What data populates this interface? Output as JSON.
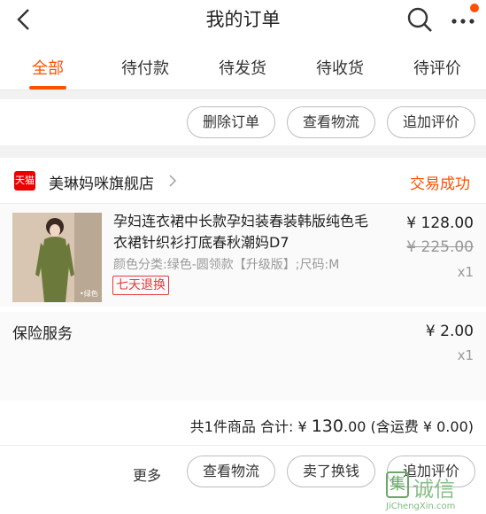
{
  "header": {
    "title": "我的订单"
  },
  "tabs": [
    {
      "label": "全部",
      "active": true
    },
    {
      "label": "待付款",
      "active": false
    },
    {
      "label": "待发货",
      "active": false
    },
    {
      "label": "待收货",
      "active": false
    },
    {
      "label": "待评价",
      "active": false
    }
  ],
  "previous_order": {
    "actions": [
      "删除订单",
      "查看物流",
      "追加评价"
    ]
  },
  "order": {
    "shop_logo_text": "天猫",
    "shop_name": "美琳妈咪旗舰店",
    "status": "交易成功",
    "item": {
      "title": "孕妇连衣裙中长款孕妇装春装韩版纯色毛衣裙针织衫打底春秋潮妈D7",
      "sku": "颜色分类:绿色-圆领款【升级版】;尺码:M",
      "tag": "七天退换",
      "price": "¥ 128.00",
      "original_price": "¥ 225.00",
      "quantity": "x1",
      "thumb_caption": "•绿色"
    },
    "insurance": {
      "label": "保险服务",
      "price": "¥ 2.00",
      "quantity": "x1"
    },
    "summary": {
      "count_text": "共1件商品",
      "total_label": "合计:",
      "currency": "¥",
      "total": "130",
      "total_decimals": ".00",
      "shipping_text": "(含运费 ¥ 0.00)"
    },
    "more_label": "更多",
    "actions": [
      "查看物流",
      "卖了换钱",
      "追加评价"
    ]
  },
  "watermark": {
    "box_char": "集",
    "text": "诚信",
    "url": "JiChengXin.com"
  },
  "colors": {
    "accent": "#ff5000",
    "tag": "#e4393c"
  }
}
